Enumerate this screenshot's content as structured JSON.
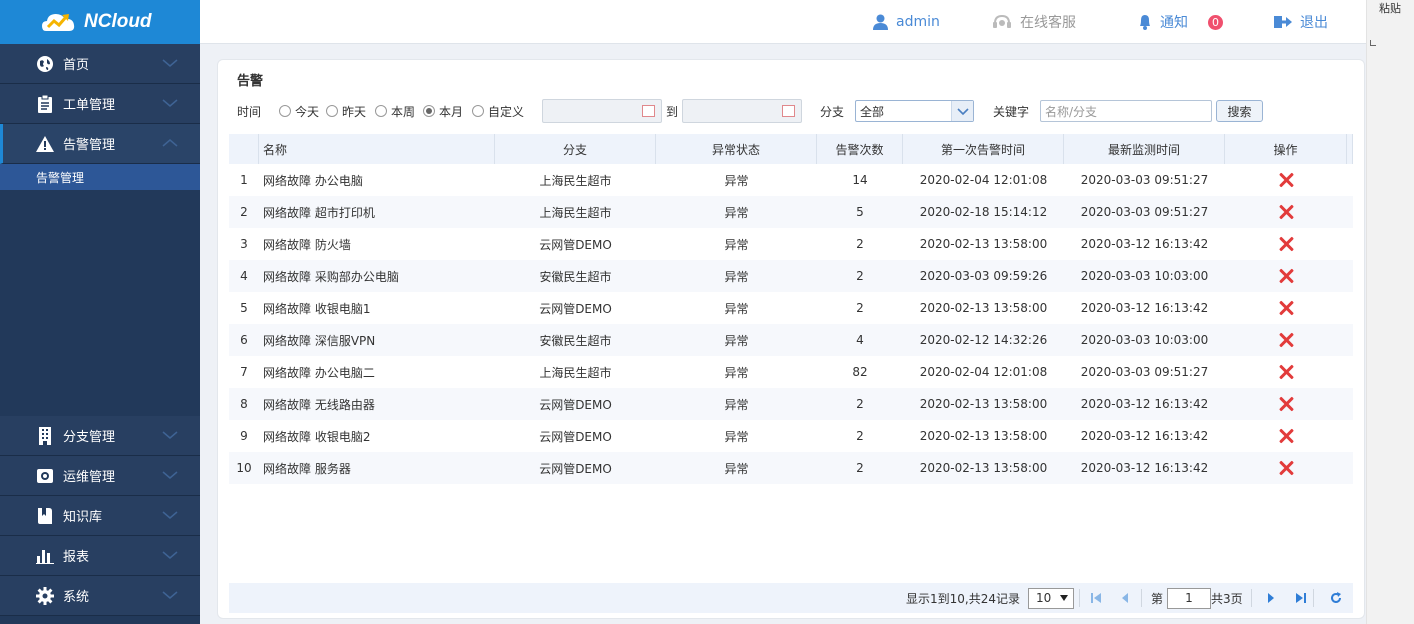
{
  "app": {
    "name": "NCloud"
  },
  "header": {
    "user": "admin",
    "support": "在线客服",
    "notice": "通知",
    "notice_count": "0",
    "logout": "退出"
  },
  "clipboard": {
    "paste": "粘贴"
  },
  "sidebar": {
    "items": [
      {
        "label": "首页",
        "icon": "globe-icon"
      },
      {
        "label": "工单管理",
        "icon": "clipboard-icon"
      },
      {
        "label": "告警管理",
        "icon": "warning-icon"
      },
      {
        "label": "分支管理",
        "icon": "building-icon"
      },
      {
        "label": "运维管理",
        "icon": "toolbox-icon"
      },
      {
        "label": "知识库",
        "icon": "book-icon"
      },
      {
        "label": "报表",
        "icon": "bar-chart-icon"
      },
      {
        "label": "系统",
        "icon": "gear-icon"
      }
    ],
    "sub_active": "告警管理"
  },
  "panel": {
    "title": "告警"
  },
  "filters": {
    "time_label": "时间",
    "options": [
      "今天",
      "昨天",
      "本周",
      "本月",
      "自定义"
    ],
    "selected": "本月",
    "to_label": "到",
    "branch_label": "分支",
    "branch_value": "全部",
    "keyword_label": "关键字",
    "keyword_placeholder": "名称/分支",
    "search_button": "搜索"
  },
  "table": {
    "columns": [
      "名称",
      "分支",
      "异常状态",
      "告警次数",
      "第一次告警时间",
      "最新监测时间",
      "操作"
    ],
    "rows": [
      {
        "no": "1",
        "name": "网络故障 办公电脑",
        "branch": "上海民生超市",
        "status": "异常",
        "count": "14",
        "first": "2020-02-04 12:01:08",
        "latest": "2020-03-03 09:51:27"
      },
      {
        "no": "2",
        "name": "网络故障 超市打印机",
        "branch": "上海民生超市",
        "status": "异常",
        "count": "5",
        "first": "2020-02-18 15:14:12",
        "latest": "2020-03-03 09:51:27"
      },
      {
        "no": "3",
        "name": "网络故障 防火墙",
        "branch": "云网管DEMO",
        "status": "异常",
        "count": "2",
        "first": "2020-02-13 13:58:00",
        "latest": "2020-03-12 16:13:42"
      },
      {
        "no": "4",
        "name": "网络故障 采购部办公电脑",
        "branch": "安徽民生超市",
        "status": "异常",
        "count": "2",
        "first": "2020-03-03 09:59:26",
        "latest": "2020-03-03 10:03:00"
      },
      {
        "no": "5",
        "name": "网络故障 收银电脑1",
        "branch": "云网管DEMO",
        "status": "异常",
        "count": "2",
        "first": "2020-02-13 13:58:00",
        "latest": "2020-03-12 16:13:42"
      },
      {
        "no": "6",
        "name": "网络故障 深信服VPN",
        "branch": "安徽民生超市",
        "status": "异常",
        "count": "4",
        "first": "2020-02-12 14:32:26",
        "latest": "2020-03-03 10:03:00"
      },
      {
        "no": "7",
        "name": "网络故障 办公电脑二",
        "branch": "上海民生超市",
        "status": "异常",
        "count": "82",
        "first": "2020-02-04 12:01:08",
        "latest": "2020-03-03 09:51:27"
      },
      {
        "no": "8",
        "name": "网络故障 无线路由器",
        "branch": "云网管DEMO",
        "status": "异常",
        "count": "2",
        "first": "2020-02-13 13:58:00",
        "latest": "2020-03-12 16:13:42"
      },
      {
        "no": "9",
        "name": "网络故障 收银电脑2",
        "branch": "云网管DEMO",
        "status": "异常",
        "count": "2",
        "first": "2020-02-13 13:58:00",
        "latest": "2020-03-12 16:13:42"
      },
      {
        "no": "10",
        "name": "网络故障 服务器",
        "branch": "云网管DEMO",
        "status": "异常",
        "count": "2",
        "first": "2020-02-13 13:58:00",
        "latest": "2020-03-12 16:13:42"
      }
    ]
  },
  "pagination": {
    "summary": "显示1到10,共24记录",
    "page_size": "10",
    "page_label": "第",
    "page": "1",
    "total_label": "共3页"
  },
  "colors": {
    "brand": "#1e88d6",
    "sidebar": "#22395a",
    "delete": "#e23b3b"
  }
}
